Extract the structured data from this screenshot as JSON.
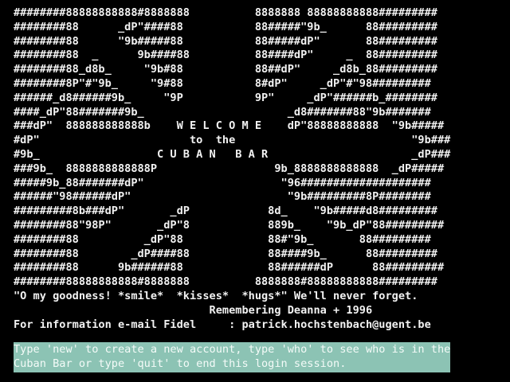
{
  "banner": {
    "ascii_art": [
      "########88888888888#8888888          8888888 88888888888#########",
      "########88      _dP\"####88           88#####\"9b_      88#########",
      "########88      \"9b#####88           88#####dP\"       88#########",
      "########88  _      9b####88          88####dP\"     _  88#########",
      "########88_d8b_     \"9b#88           88##dP\"     _d8b_88#########",
      "########8P\"#\"9b_     \"9#88           8#dP\"     _dP\"#\"98#########",
      "######_d8######9b_     \"9P           9P\"     _dP\"######b_########",
      "####_dP\"88#######9b_                      _d8#######88\"9b#######",
      "###dP\"  888888888888b    W E L C O M E    dP\"88888888888  \"9b#####",
      "#dP\"                       to  the                           \"9b###",
      "#9b_                  C U B A N   B A R                      _dP###",
      "###9b_  8888888888888P                  9b_8888888888888  _dP#####",
      "#####9b_88#######dP\"                     \"96####################",
      "######\"98######dP\"                        \"9b#########8P########",
      "#########8b###dP\"       _dP            8d_    \"9b#####d8#########",
      "########88\"98P\"       _dP\"8            889b_    \"9b_dP\"88#########",
      "########88          _dP\"88             88#\"9b_       88#########",
      "########88        _dP####88            88####9b_      88#########",
      "########88      9b######88             88######dP      88#########",
      "########88888888888#8888888          8888888#88888888888#########"
    ]
  },
  "messages": {
    "line1": "\"O my goodness! *smile*  *kisses*  *hugs*\" We'll never forget.",
    "line2": "                              Remembering Deanna + 1996",
    "line3": "For information e-mail Fidel     : patrick.hochstenbach@ugent.be"
  },
  "prompt": {
    "line1": "Type 'new' to create a new account, type 'who' to see who is in the",
    "line2": "Cuban Bar or type 'quit' to end this login session."
  },
  "colors": {
    "background": "#000000",
    "text": "#f2f2f2",
    "prompt_highlight": "#8cc3b4"
  }
}
